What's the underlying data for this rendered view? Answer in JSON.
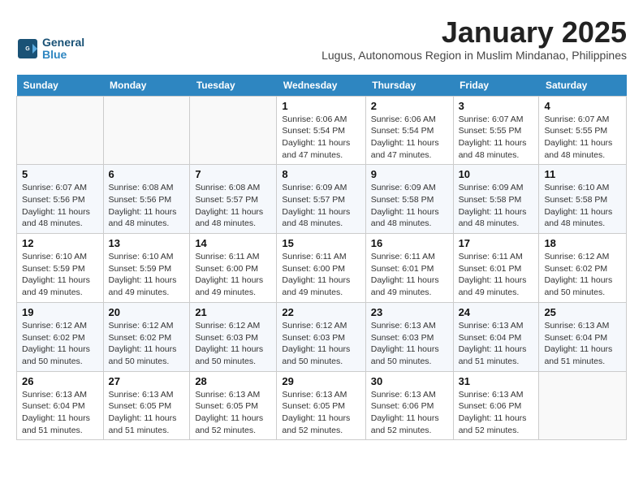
{
  "header": {
    "logo_line1": "General",
    "logo_line2": "Blue",
    "month": "January 2025",
    "subtitle": "Lugus, Autonomous Region in Muslim Mindanao, Philippines"
  },
  "days_of_week": [
    "Sunday",
    "Monday",
    "Tuesday",
    "Wednesday",
    "Thursday",
    "Friday",
    "Saturday"
  ],
  "weeks": [
    [
      {
        "day": "",
        "info": ""
      },
      {
        "day": "",
        "info": ""
      },
      {
        "day": "",
        "info": ""
      },
      {
        "day": "1",
        "info": "Sunrise: 6:06 AM\nSunset: 5:54 PM\nDaylight: 11 hours and 47 minutes."
      },
      {
        "day": "2",
        "info": "Sunrise: 6:06 AM\nSunset: 5:54 PM\nDaylight: 11 hours and 47 minutes."
      },
      {
        "day": "3",
        "info": "Sunrise: 6:07 AM\nSunset: 5:55 PM\nDaylight: 11 hours and 48 minutes."
      },
      {
        "day": "4",
        "info": "Sunrise: 6:07 AM\nSunset: 5:55 PM\nDaylight: 11 hours and 48 minutes."
      }
    ],
    [
      {
        "day": "5",
        "info": "Sunrise: 6:07 AM\nSunset: 5:56 PM\nDaylight: 11 hours and 48 minutes."
      },
      {
        "day": "6",
        "info": "Sunrise: 6:08 AM\nSunset: 5:56 PM\nDaylight: 11 hours and 48 minutes."
      },
      {
        "day": "7",
        "info": "Sunrise: 6:08 AM\nSunset: 5:57 PM\nDaylight: 11 hours and 48 minutes."
      },
      {
        "day": "8",
        "info": "Sunrise: 6:09 AM\nSunset: 5:57 PM\nDaylight: 11 hours and 48 minutes."
      },
      {
        "day": "9",
        "info": "Sunrise: 6:09 AM\nSunset: 5:58 PM\nDaylight: 11 hours and 48 minutes."
      },
      {
        "day": "10",
        "info": "Sunrise: 6:09 AM\nSunset: 5:58 PM\nDaylight: 11 hours and 48 minutes."
      },
      {
        "day": "11",
        "info": "Sunrise: 6:10 AM\nSunset: 5:58 PM\nDaylight: 11 hours and 48 minutes."
      }
    ],
    [
      {
        "day": "12",
        "info": "Sunrise: 6:10 AM\nSunset: 5:59 PM\nDaylight: 11 hours and 49 minutes."
      },
      {
        "day": "13",
        "info": "Sunrise: 6:10 AM\nSunset: 5:59 PM\nDaylight: 11 hours and 49 minutes."
      },
      {
        "day": "14",
        "info": "Sunrise: 6:11 AM\nSunset: 6:00 PM\nDaylight: 11 hours and 49 minutes."
      },
      {
        "day": "15",
        "info": "Sunrise: 6:11 AM\nSunset: 6:00 PM\nDaylight: 11 hours and 49 minutes."
      },
      {
        "day": "16",
        "info": "Sunrise: 6:11 AM\nSunset: 6:01 PM\nDaylight: 11 hours and 49 minutes."
      },
      {
        "day": "17",
        "info": "Sunrise: 6:11 AM\nSunset: 6:01 PM\nDaylight: 11 hours and 49 minutes."
      },
      {
        "day": "18",
        "info": "Sunrise: 6:12 AM\nSunset: 6:02 PM\nDaylight: 11 hours and 50 minutes."
      }
    ],
    [
      {
        "day": "19",
        "info": "Sunrise: 6:12 AM\nSunset: 6:02 PM\nDaylight: 11 hours and 50 minutes."
      },
      {
        "day": "20",
        "info": "Sunrise: 6:12 AM\nSunset: 6:02 PM\nDaylight: 11 hours and 50 minutes."
      },
      {
        "day": "21",
        "info": "Sunrise: 6:12 AM\nSunset: 6:03 PM\nDaylight: 11 hours and 50 minutes."
      },
      {
        "day": "22",
        "info": "Sunrise: 6:12 AM\nSunset: 6:03 PM\nDaylight: 11 hours and 50 minutes."
      },
      {
        "day": "23",
        "info": "Sunrise: 6:13 AM\nSunset: 6:03 PM\nDaylight: 11 hours and 50 minutes."
      },
      {
        "day": "24",
        "info": "Sunrise: 6:13 AM\nSunset: 6:04 PM\nDaylight: 11 hours and 51 minutes."
      },
      {
        "day": "25",
        "info": "Sunrise: 6:13 AM\nSunset: 6:04 PM\nDaylight: 11 hours and 51 minutes."
      }
    ],
    [
      {
        "day": "26",
        "info": "Sunrise: 6:13 AM\nSunset: 6:04 PM\nDaylight: 11 hours and 51 minutes."
      },
      {
        "day": "27",
        "info": "Sunrise: 6:13 AM\nSunset: 6:05 PM\nDaylight: 11 hours and 51 minutes."
      },
      {
        "day": "28",
        "info": "Sunrise: 6:13 AM\nSunset: 6:05 PM\nDaylight: 11 hours and 52 minutes."
      },
      {
        "day": "29",
        "info": "Sunrise: 6:13 AM\nSunset: 6:05 PM\nDaylight: 11 hours and 52 minutes."
      },
      {
        "day": "30",
        "info": "Sunrise: 6:13 AM\nSunset: 6:06 PM\nDaylight: 11 hours and 52 minutes."
      },
      {
        "day": "31",
        "info": "Sunrise: 6:13 AM\nSunset: 6:06 PM\nDaylight: 11 hours and 52 minutes."
      },
      {
        "day": "",
        "info": ""
      }
    ]
  ]
}
